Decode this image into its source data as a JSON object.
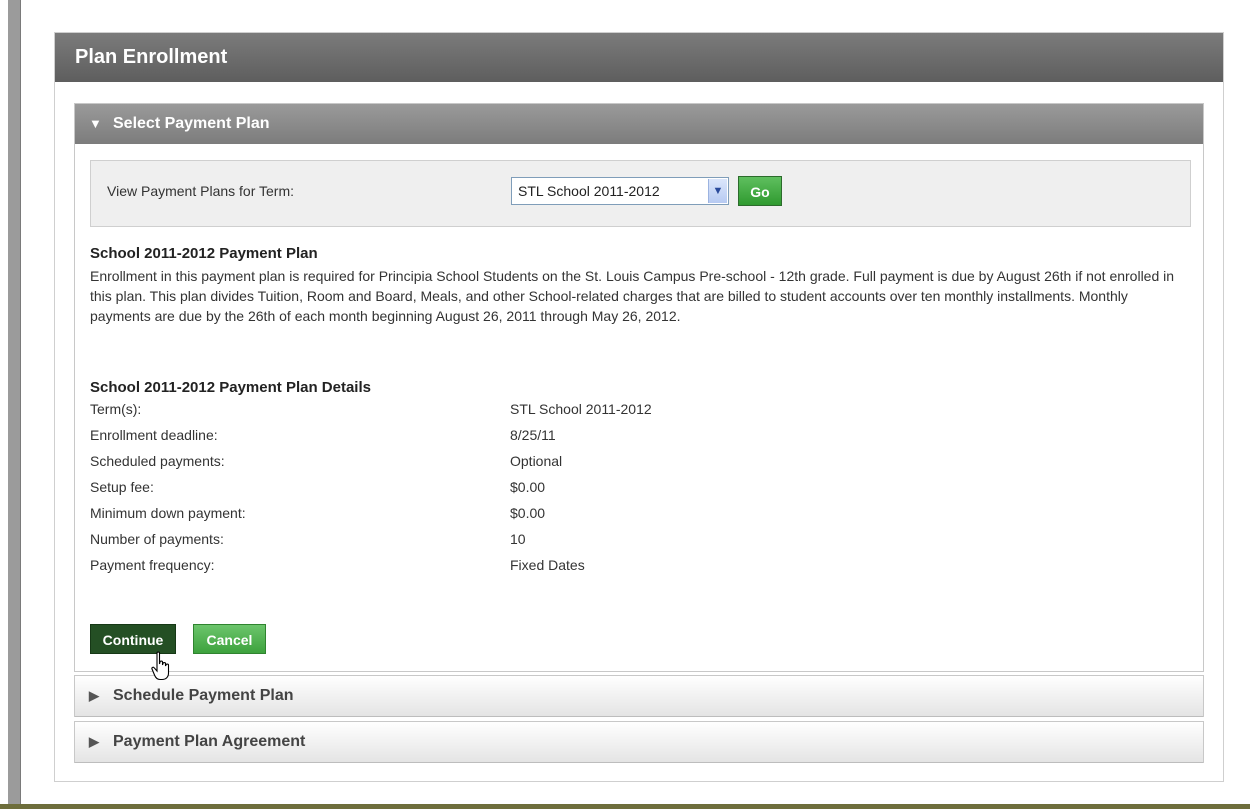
{
  "panel": {
    "title": "Plan Enrollment"
  },
  "sections": {
    "select": {
      "title": "Select Payment Plan",
      "expanded": true
    },
    "schedule": {
      "title": "Schedule Payment Plan",
      "expanded": false
    },
    "agreement": {
      "title": "Payment Plan Agreement",
      "expanded": false
    }
  },
  "term": {
    "label": "View Payment Plans for Term:",
    "selected": "STL School 2011-2012",
    "go_label": "Go"
  },
  "plan": {
    "title": "School 2011-2012 Payment Plan",
    "description": "Enrollment in this payment plan is required for Principia School Students on the St. Louis Campus Pre-school - 12th grade. Full payment is due by August 26th if not enrolled in this plan. This plan divides Tuition, Room and Board, Meals, and other School-related charges that are billed to student accounts over ten monthly installments. Monthly payments are due by the 26th of each month beginning August 26, 2011 through May 26, 2012.",
    "details_title": "School 2011-2012 Payment Plan Details",
    "details": [
      {
        "label": "Term(s):",
        "value": "STL School 2011-2012"
      },
      {
        "label": "Enrollment deadline:",
        "value": "8/25/11"
      },
      {
        "label": "Scheduled payments:",
        "value": "Optional"
      },
      {
        "label": "Setup fee:",
        "value": "$0.00"
      },
      {
        "label": "Minimum down payment:",
        "value": "$0.00"
      },
      {
        "label": "Number of payments:",
        "value": "10"
      },
      {
        "label": "Payment frequency:",
        "value": "Fixed Dates"
      }
    ]
  },
  "actions": {
    "continue_label": "Continue",
    "cancel_label": "Cancel"
  },
  "colors": {
    "header_bg": "#6b6b6b",
    "section_active_bg": "#8a8a8a",
    "go_button": "#3fa83f",
    "continue_button": "#244f24",
    "cancel_button": "#4fb24f"
  },
  "icons": {
    "expanded": "triangle-down-icon",
    "collapsed": "triangle-right-icon",
    "select_arrow": "chevron-down-icon",
    "cursor": "hand-pointer-icon"
  }
}
